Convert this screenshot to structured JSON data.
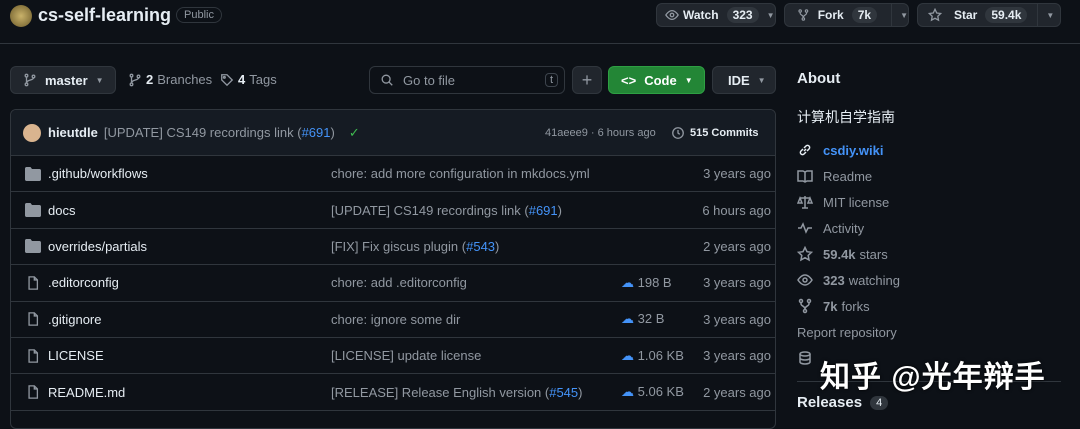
{
  "repo": {
    "name": "cs-self-learning",
    "visibility": "Public"
  },
  "actions": {
    "watch_label": "Watch",
    "watch_count": "323",
    "fork_label": "Fork",
    "fork_count": "7k",
    "star_label": "Star",
    "star_count": "59.4k"
  },
  "toolbar": {
    "branch": "master",
    "branches_count": "2",
    "branches_label": "Branches",
    "tags_count": "4",
    "tags_label": "Tags",
    "search_placeholder": "Go to file",
    "search_shortcut": "t",
    "add_label": "+",
    "code_label": "Code",
    "ide_label": "IDE"
  },
  "commit": {
    "author": "hieutdle",
    "message": "[UPDATE] CS149 recordings link (",
    "pr": "#691",
    "message_end": ")",
    "hash_time": "41aeee9 · 6 hours ago",
    "commits": "515 Commits"
  },
  "files": [
    {
      "type": "folder",
      "name": ".github/workflows",
      "msg": "chore: add more configuration in mkdocs.yml",
      "pr": "",
      "size": "",
      "age": "3 years ago"
    },
    {
      "type": "folder",
      "name": "docs",
      "msg": "[UPDATE] CS149 recordings link (",
      "pr": "#691",
      "size": "",
      "age": "6 hours ago"
    },
    {
      "type": "folder",
      "name": "overrides/partials",
      "msg": "[FIX] Fix giscus plugin (",
      "pr": "#543",
      "size": "",
      "age": "2 years ago"
    },
    {
      "type": "file",
      "name": ".editorconfig",
      "msg": "chore: add .editorconfig",
      "pr": "",
      "size": "198 B",
      "age": "3 years ago"
    },
    {
      "type": "file",
      "name": ".gitignore",
      "msg": "chore: ignore some dir",
      "pr": "",
      "size": "32 B",
      "age": "3 years ago"
    },
    {
      "type": "file",
      "name": "LICENSE",
      "msg": "[LICENSE] update license",
      "pr": "",
      "size": "1.06 KB",
      "age": "3 years ago"
    },
    {
      "type": "file",
      "name": "README.md",
      "msg": "[RELEASE] Release English version (",
      "pr": "#545",
      "size": "5.06 KB",
      "age": "2 years ago"
    }
  ],
  "about": {
    "title": "About",
    "description": "计算机自学指南",
    "website": "csdiy.wiki",
    "readme": "Readme",
    "license": "MIT license",
    "activity": "Activity",
    "stars_count": "59.4k",
    "stars_label": "stars",
    "watching_count": "323",
    "watching_label": "watching",
    "forks_count": "7k",
    "forks_label": "forks",
    "report": "Report repository",
    "releases_label": "Releases",
    "releases_count": "4"
  },
  "watermark": "知乎 @光年辩手",
  "colors": {
    "bg": "#0d1117",
    "accent_green": "#238636",
    "link": "#4493f8"
  }
}
